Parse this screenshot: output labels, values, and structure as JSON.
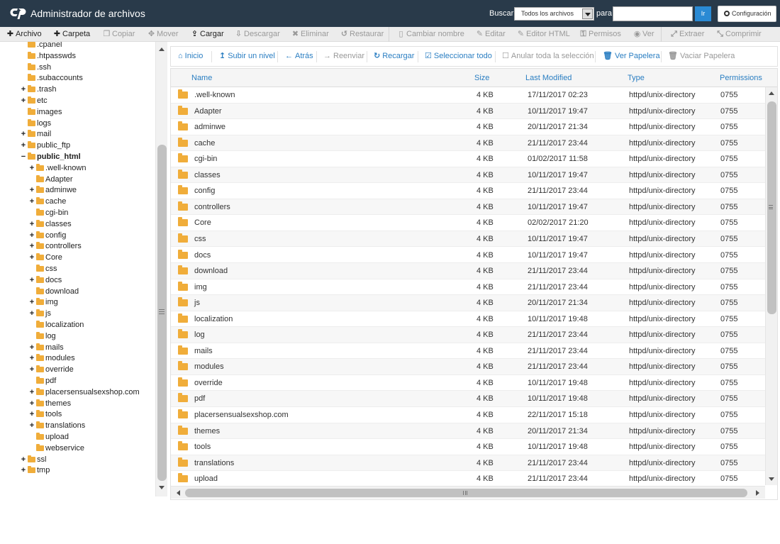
{
  "app": {
    "logo_text": "cP",
    "title": "Administrador de archivos"
  },
  "search": {
    "label": "Buscar",
    "scope_selected": "Todos los archivos",
    "for_label": "para",
    "query": "",
    "go_label": "Ir"
  },
  "settings_label": "Configuración",
  "toolbar": [
    {
      "label": "Archivo",
      "icon": "plus-icon",
      "active": true
    },
    {
      "label": "Carpeta",
      "icon": "plus-icon",
      "active": true
    },
    {
      "label": "Copiar",
      "icon": "copy-icon",
      "active": false
    },
    {
      "label": "Mover",
      "icon": "move-icon",
      "active": false
    },
    {
      "label": "Cargar",
      "icon": "upload-icon",
      "active": true
    },
    {
      "label": "Descargar",
      "icon": "download-icon",
      "active": false
    },
    {
      "label": "Eliminar",
      "icon": "delete-icon",
      "active": false
    },
    {
      "label": "Restaurar",
      "icon": "restore-icon",
      "active": false
    },
    {
      "label": "Cambiar nombre",
      "icon": "file-icon",
      "active": false
    },
    {
      "label": "Editar",
      "icon": "pencil-icon",
      "active": false
    },
    {
      "label": "Editor HTML",
      "icon": "edit-icon",
      "active": false
    },
    {
      "label": "Permisos",
      "icon": "key-icon",
      "active": false
    },
    {
      "label": "Ver",
      "icon": "eye-icon",
      "active": false
    },
    {
      "label": "Extraer",
      "icon": "expand-icon",
      "active": false
    },
    {
      "label": "Comprimir",
      "icon": "compress-icon",
      "active": false
    }
  ],
  "tree": [
    {
      "label": ".cpanel",
      "level": 1,
      "toggle": ""
    },
    {
      "label": ".htpasswds",
      "level": 1,
      "toggle": ""
    },
    {
      "label": ".ssh",
      "level": 1,
      "toggle": ""
    },
    {
      "label": ".subaccounts",
      "level": 1,
      "toggle": ""
    },
    {
      "label": ".trash",
      "level": 1,
      "toggle": "+"
    },
    {
      "label": "etc",
      "level": 1,
      "toggle": "+"
    },
    {
      "label": "images",
      "level": 1,
      "toggle": ""
    },
    {
      "label": "logs",
      "level": 1,
      "toggle": ""
    },
    {
      "label": "mail",
      "level": 1,
      "toggle": "+"
    },
    {
      "label": "public_ftp",
      "level": 1,
      "toggle": "+"
    },
    {
      "label": "public_html",
      "level": 1,
      "toggle": "−",
      "bold": true
    },
    {
      "label": ".well-known",
      "level": 2,
      "toggle": "+"
    },
    {
      "label": "Adapter",
      "level": 2,
      "toggle": ""
    },
    {
      "label": "adminwe",
      "level": 2,
      "toggle": "+"
    },
    {
      "label": "cache",
      "level": 2,
      "toggle": "+"
    },
    {
      "label": "cgi-bin",
      "level": 2,
      "toggle": ""
    },
    {
      "label": "classes",
      "level": 2,
      "toggle": "+"
    },
    {
      "label": "config",
      "level": 2,
      "toggle": "+"
    },
    {
      "label": "controllers",
      "level": 2,
      "toggle": "+"
    },
    {
      "label": "Core",
      "level": 2,
      "toggle": "+"
    },
    {
      "label": "css",
      "level": 2,
      "toggle": ""
    },
    {
      "label": "docs",
      "level": 2,
      "toggle": "+"
    },
    {
      "label": "download",
      "level": 2,
      "toggle": ""
    },
    {
      "label": "img",
      "level": 2,
      "toggle": "+"
    },
    {
      "label": "js",
      "level": 2,
      "toggle": "+"
    },
    {
      "label": "localization",
      "level": 2,
      "toggle": ""
    },
    {
      "label": "log",
      "level": 2,
      "toggle": ""
    },
    {
      "label": "mails",
      "level": 2,
      "toggle": "+"
    },
    {
      "label": "modules",
      "level": 2,
      "toggle": "+"
    },
    {
      "label": "override",
      "level": 2,
      "toggle": "+"
    },
    {
      "label": "pdf",
      "level": 2,
      "toggle": ""
    },
    {
      "label": "placersensualsexshop.com",
      "level": 2,
      "toggle": "+"
    },
    {
      "label": "themes",
      "level": 2,
      "toggle": "+"
    },
    {
      "label": "tools",
      "level": 2,
      "toggle": "+"
    },
    {
      "label": "translations",
      "level": 2,
      "toggle": "+"
    },
    {
      "label": "upload",
      "level": 2,
      "toggle": ""
    },
    {
      "label": "webservice",
      "level": 2,
      "toggle": ""
    },
    {
      "label": "ssl",
      "level": 1,
      "toggle": "+"
    },
    {
      "label": "tmp",
      "level": 1,
      "toggle": "+"
    }
  ],
  "nav": [
    {
      "label": "Inicio",
      "icon": "home-icon",
      "enabled": true
    },
    {
      "label": "Subir un nivel",
      "icon": "level-up-icon",
      "enabled": true
    },
    {
      "label": "Atrás",
      "icon": "arrow-left-icon",
      "enabled": true
    },
    {
      "label": "Reenviar",
      "icon": "arrow-right-icon",
      "enabled": false
    },
    {
      "label": "Recargar",
      "icon": "refresh-icon",
      "enabled": true
    },
    {
      "label": "Seleccionar todo",
      "icon": "check-square-icon",
      "enabled": true
    },
    {
      "label": "Anular toda la selección",
      "icon": "square-icon",
      "enabled": false
    },
    {
      "label": "Ver Papelera",
      "icon": "trash-icon",
      "enabled": true
    },
    {
      "label": "Vaciar Papelera",
      "icon": "trash-icon",
      "enabled": false
    }
  ],
  "table": {
    "columns": [
      "Name",
      "Size",
      "Last Modified",
      "Type",
      "Permissions"
    ],
    "rows": [
      {
        "name": ".well-known",
        "size": "4 KB",
        "modified": "17/11/2017 02:23",
        "type": "httpd/unix-directory",
        "perms": "0755"
      },
      {
        "name": "Adapter",
        "size": "4 KB",
        "modified": "10/11/2017 19:47",
        "type": "httpd/unix-directory",
        "perms": "0755"
      },
      {
        "name": "adminwe",
        "size": "4 KB",
        "modified": "20/11/2017 21:34",
        "type": "httpd/unix-directory",
        "perms": "0755"
      },
      {
        "name": "cache",
        "size": "4 KB",
        "modified": "21/11/2017 23:44",
        "type": "httpd/unix-directory",
        "perms": "0755"
      },
      {
        "name": "cgi-bin",
        "size": "4 KB",
        "modified": "01/02/2017 11:58",
        "type": "httpd/unix-directory",
        "perms": "0755"
      },
      {
        "name": "classes",
        "size": "4 KB",
        "modified": "10/11/2017 19:47",
        "type": "httpd/unix-directory",
        "perms": "0755"
      },
      {
        "name": "config",
        "size": "4 KB",
        "modified": "21/11/2017 23:44",
        "type": "httpd/unix-directory",
        "perms": "0755"
      },
      {
        "name": "controllers",
        "size": "4 KB",
        "modified": "10/11/2017 19:47",
        "type": "httpd/unix-directory",
        "perms": "0755"
      },
      {
        "name": "Core",
        "size": "4 KB",
        "modified": "02/02/2017 21:20",
        "type": "httpd/unix-directory",
        "perms": "0755"
      },
      {
        "name": "css",
        "size": "4 KB",
        "modified": "10/11/2017 19:47",
        "type": "httpd/unix-directory",
        "perms": "0755"
      },
      {
        "name": "docs",
        "size": "4 KB",
        "modified": "10/11/2017 19:47",
        "type": "httpd/unix-directory",
        "perms": "0755"
      },
      {
        "name": "download",
        "size": "4 KB",
        "modified": "21/11/2017 23:44",
        "type": "httpd/unix-directory",
        "perms": "0755"
      },
      {
        "name": "img",
        "size": "4 KB",
        "modified": "21/11/2017 23:44",
        "type": "httpd/unix-directory",
        "perms": "0755"
      },
      {
        "name": "js",
        "size": "4 KB",
        "modified": "20/11/2017 21:34",
        "type": "httpd/unix-directory",
        "perms": "0755"
      },
      {
        "name": "localization",
        "size": "4 KB",
        "modified": "10/11/2017 19:48",
        "type": "httpd/unix-directory",
        "perms": "0755"
      },
      {
        "name": "log",
        "size": "4 KB",
        "modified": "21/11/2017 23:44",
        "type": "httpd/unix-directory",
        "perms": "0755"
      },
      {
        "name": "mails",
        "size": "4 KB",
        "modified": "21/11/2017 23:44",
        "type": "httpd/unix-directory",
        "perms": "0755"
      },
      {
        "name": "modules",
        "size": "4 KB",
        "modified": "21/11/2017 23:44",
        "type": "httpd/unix-directory",
        "perms": "0755"
      },
      {
        "name": "override",
        "size": "4 KB",
        "modified": "10/11/2017 19:48",
        "type": "httpd/unix-directory",
        "perms": "0755"
      },
      {
        "name": "pdf",
        "size": "4 KB",
        "modified": "10/11/2017 19:48",
        "type": "httpd/unix-directory",
        "perms": "0755"
      },
      {
        "name": "placersensualsexshop.com",
        "size": "4 KB",
        "modified": "22/11/2017 15:18",
        "type": "httpd/unix-directory",
        "perms": "0755"
      },
      {
        "name": "themes",
        "size": "4 KB",
        "modified": "20/11/2017 21:34",
        "type": "httpd/unix-directory",
        "perms": "0755"
      },
      {
        "name": "tools",
        "size": "4 KB",
        "modified": "10/11/2017 19:48",
        "type": "httpd/unix-directory",
        "perms": "0755"
      },
      {
        "name": "translations",
        "size": "4 KB",
        "modified": "21/11/2017 23:44",
        "type": "httpd/unix-directory",
        "perms": "0755"
      },
      {
        "name": "upload",
        "size": "4 KB",
        "modified": "21/11/2017 23:44",
        "type": "httpd/unix-directory",
        "perms": "0755"
      }
    ]
  },
  "colors": {
    "topbar": "#293a4a",
    "link": "#2a7ec2",
    "folder": "#f0ad3a",
    "go_button": "#2a8ad4"
  }
}
